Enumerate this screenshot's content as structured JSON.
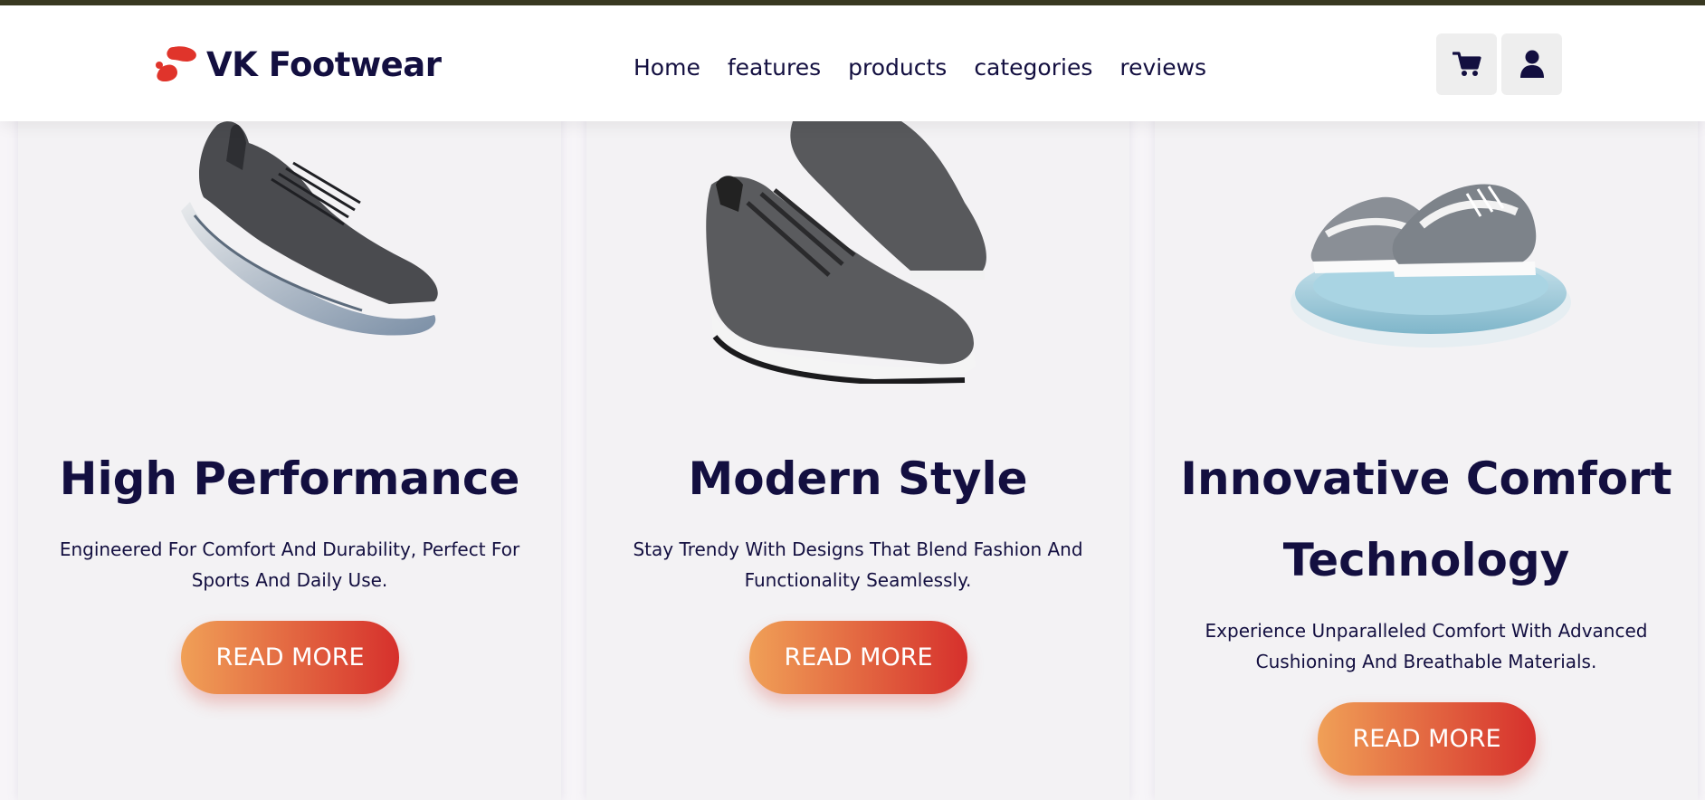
{
  "brand": {
    "name": "VK Footwear",
    "logo_icon": "footprints-icon",
    "accent_color": "#e0342b"
  },
  "nav": {
    "items": [
      {
        "label": "Home"
      },
      {
        "label": "features"
      },
      {
        "label": "products"
      },
      {
        "label": "categories"
      },
      {
        "label": "reviews"
      }
    ]
  },
  "header_actions": {
    "cart_icon": "shopping-cart-icon",
    "user_icon": "user-icon"
  },
  "cards": [
    {
      "title": "High Performance",
      "description": "Engineered For Comfort And Durability, Perfect For Sports And Daily Use.",
      "button": "READ MORE",
      "image": "running-shoe-image"
    },
    {
      "title": "Modern Style",
      "description": "Stay Trendy With Designs That Blend Fashion And Functionality Seamlessly.",
      "button": "READ MORE",
      "image": "casual-sneakers-image"
    },
    {
      "title": "Innovative Comfort Technology",
      "description": "Experience Unparalleled Comfort With Advanced Cushioning And Breathable Materials.",
      "button": "READ MORE",
      "image": "sneakers-on-platform-image"
    }
  ],
  "colors": {
    "text": "#130f40",
    "button_gradient_start": "#f0a057",
    "button_gradient_end": "#d6302c",
    "card_bg": "#f3f2f4"
  }
}
